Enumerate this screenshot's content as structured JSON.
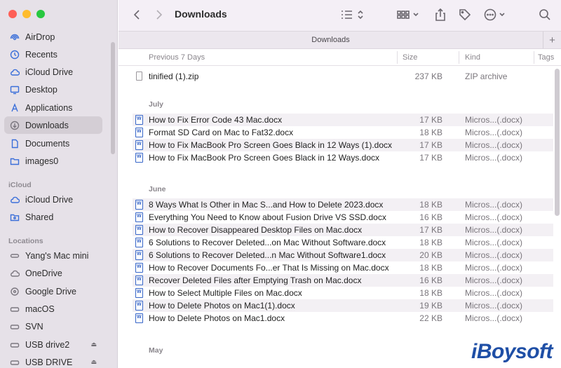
{
  "window": {
    "title": "Downloads"
  },
  "tab": {
    "title": "Downloads"
  },
  "sidebar": {
    "favorites": [
      {
        "label": "AirDrop",
        "icon": "airdrop-icon"
      },
      {
        "label": "Recents",
        "icon": "clock-icon"
      },
      {
        "label": "iCloud Drive",
        "icon": "cloud-icon"
      },
      {
        "label": "Desktop",
        "icon": "desktop-icon"
      },
      {
        "label": "Applications",
        "icon": "applications-icon"
      },
      {
        "label": "Downloads",
        "icon": "download-icon",
        "active": true
      },
      {
        "label": "Documents",
        "icon": "document-icon"
      },
      {
        "label": "images0",
        "icon": "folder-icon"
      }
    ],
    "icloud_header": "iCloud",
    "icloud": [
      {
        "label": "iCloud Drive",
        "icon": "cloud-icon"
      },
      {
        "label": "Shared",
        "icon": "shared-folder-icon"
      }
    ],
    "locations_header": "Locations",
    "locations": [
      {
        "label": "Yang's Mac mini",
        "icon": "computer-icon"
      },
      {
        "label": "OneDrive",
        "icon": "cloud-icon"
      },
      {
        "label": "Google Drive",
        "icon": "drive-icon"
      },
      {
        "label": "macOS",
        "icon": "disk-icon"
      },
      {
        "label": "SVN",
        "icon": "disk-icon"
      },
      {
        "label": "USB drive2",
        "icon": "disk-icon",
        "eject": true
      },
      {
        "label": "USB DRIVE",
        "icon": "disk-icon",
        "eject": true
      }
    ]
  },
  "columns": {
    "name": "Previous 7 Days",
    "size": "Size",
    "kind": "Kind",
    "tags": "Tags"
  },
  "groups": {
    "recent": [
      {
        "name": "tinified (1).zip",
        "size": "237 KB",
        "kind": "ZIP archive"
      }
    ],
    "july_label": "July",
    "july": [
      {
        "name": "How to Fix Error Code 43 Mac.docx",
        "size": "17 KB",
        "kind": "Micros...(.docx)"
      },
      {
        "name": "Format SD Card on Mac to Fat32.docx",
        "size": "18 KB",
        "kind": "Micros...(.docx)"
      },
      {
        "name": "How to Fix MacBook Pro Screen Goes Black in 12 Ways (1).docx",
        "size": "17 KB",
        "kind": "Micros...(.docx)"
      },
      {
        "name": "How to Fix MacBook Pro Screen Goes Black in 12 Ways.docx",
        "size": "17 KB",
        "kind": "Micros...(.docx)"
      }
    ],
    "june_label": "June",
    "june": [
      {
        "name": "8 Ways What Is Other in Mac S...and How to Delete 2023.docx",
        "size": "18 KB",
        "kind": "Micros...(.docx)"
      },
      {
        "name": "Everything You Need to Know about Fusion Drive VS SSD.docx",
        "size": "16 KB",
        "kind": "Micros...(.docx)"
      },
      {
        "name": "How to Recover Disappeared Desktop Files on Mac.docx",
        "size": "17 KB",
        "kind": "Micros...(.docx)"
      },
      {
        "name": "6 Solutions to Recover Deleted...on Mac Without Software.docx",
        "size": "18 KB",
        "kind": "Micros...(.docx)"
      },
      {
        "name": "6 Solutions to Recover Deleted...n Mac Without Software1.docx",
        "size": "20 KB",
        "kind": "Micros...(.docx)"
      },
      {
        "name": "How to Recover Documents Fo...er That Is Missing on Mac.docx",
        "size": "18 KB",
        "kind": "Micros...(.docx)"
      },
      {
        "name": "Recover Deleted Files after Emptying Trash on Mac.docx",
        "size": "16 KB",
        "kind": "Micros...(.docx)"
      },
      {
        "name": "How to Select Multiple Files on Mac.docx",
        "size": "18 KB",
        "kind": "Micros...(.docx)"
      },
      {
        "name": "How to Delete Photos on Mac1(1).docx",
        "size": "19 KB",
        "kind": "Micros...(.docx)"
      },
      {
        "name": "How to Delete Photos on Mac1.docx",
        "size": "22 KB",
        "kind": "Micros...(.docx)"
      }
    ],
    "may_label": "May"
  },
  "watermark": "iBoysoft",
  "colors": {
    "accent": "#3b6fd9",
    "sidebar_bg": "#e6e1e8",
    "active_bg": "#d4ced5"
  }
}
